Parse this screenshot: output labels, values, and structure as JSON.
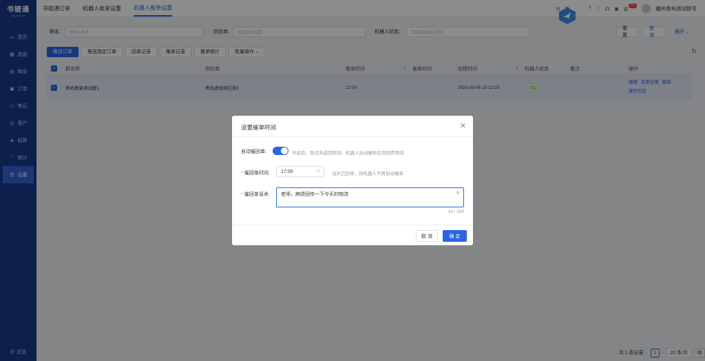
{
  "sidebar": {
    "logo": "书链通",
    "logo_sub": "SHULIANTONG",
    "items": [
      {
        "icon": "home-icon",
        "glyph": "▭",
        "label": "首页"
      },
      {
        "icon": "goods-select-icon",
        "glyph": "▦",
        "label": "选品"
      },
      {
        "icon": "product-icon",
        "glyph": "▤",
        "label": "商品"
      },
      {
        "icon": "order-icon",
        "glyph": "▣",
        "label": "订单"
      },
      {
        "icon": "after-sale-icon",
        "glyph": "◇",
        "label": "售后"
      },
      {
        "icon": "customer-icon",
        "glyph": "◎",
        "label": "客户"
      },
      {
        "icon": "settlement-icon",
        "glyph": "◈",
        "label": "结算"
      },
      {
        "icon": "stats-icon",
        "glyph": "◔",
        "label": "统计"
      },
      {
        "icon": "settings-icon",
        "glyph": "☰",
        "label": "设置"
      }
    ],
    "footer": "总览"
  },
  "topbar": {
    "tabs": [
      "书链通订单",
      "机器人收单设置",
      "机器人推单设置"
    ],
    "right_label": "新",
    "badge": "61",
    "user": "福州青屿测试账号"
  },
  "filter": {
    "group_label": "群名:",
    "group_placeholder": "请输入群名",
    "supplier_label": "供应商:",
    "supplier_placeholder": "请选择供应商",
    "robot_status_label": "机器人状态:",
    "robot_status_placeholder": "请选择机器人状态",
    "reset": "重 置",
    "search": "查 询",
    "expand": "展开"
  },
  "toolbar": {
    "buttons": [
      "推送订单",
      "推送指定订单",
      "回单记录",
      "推单记录",
      "推单统计",
      "批量操作"
    ]
  },
  "table": {
    "headers": [
      "群名称",
      "供应商",
      "推单时间",
      "催单时间",
      "创建时间",
      "机器人状态",
      "备注",
      "操作"
    ],
    "rows": [
      {
        "group": "青屿推单测试群1",
        "supplier": "青屿虚拟供应商1",
        "push_time": "12:00",
        "remind_time": "-",
        "created": "2023-05-05 10:12:25",
        "status": "开启",
        "remark": "-",
        "ops": [
          "编辑",
          "变更记录",
          "删除",
          "操作日志"
        ]
      }
    ]
  },
  "pager": {
    "total": "共 1 条记录",
    "page": "1",
    "page_size": "20 条/页",
    "ime": "中"
  },
  "dialog": {
    "title": "设置催单时间",
    "auto_label": "自动催回单:",
    "auto_on": true,
    "auto_hint": "开启后，到点未返回物流，机器人自动催供应商回传物流",
    "time_label": "催回单时间:",
    "time_value": "17:00",
    "time_hint": "当天已回单，则机器人不再自动催单",
    "script_label": "催回单话术:",
    "script_value": "老师，麻烦回传一下今天的物流",
    "counter": "14 / 200",
    "cancel": "取 消",
    "confirm": "确 定"
  }
}
